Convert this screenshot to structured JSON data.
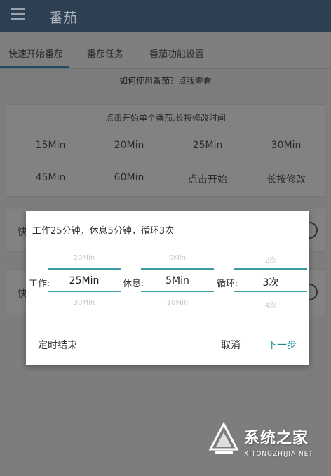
{
  "app": {
    "title": "番茄"
  },
  "tabs": [
    {
      "label": "快速开始番茄"
    },
    {
      "label": "番茄任务"
    },
    {
      "label": "番茄功能设置"
    }
  ],
  "help_link": "如何使用番茄？点我查看",
  "quick_card": {
    "title": "点击开始单个番茄,长按修改时间",
    "presets": [
      "15Min",
      "20Min",
      "25Min",
      "30Min",
      "45Min",
      "60Min",
      "点击开始",
      "长按修改"
    ]
  },
  "cards": [
    {
      "label_fragment": "快"
    },
    {
      "label_fragment": "快"
    }
  ],
  "dialog": {
    "title": "工作25分钟，休息5分钟，循环3次",
    "pickers": [
      {
        "label": "工作:",
        "prev": "20Min",
        "current": "25Min",
        "next": "30Min"
      },
      {
        "label": "休息:",
        "prev": "0Min",
        "current": "5Min",
        "next": "10Min"
      },
      {
        "label": "循环:",
        "prev": "2次",
        "current": "3次",
        "next": "4次"
      }
    ],
    "buttons": {
      "timed_end": "定时结束",
      "cancel": "取消",
      "next": "下一步"
    }
  },
  "watermark": {
    "cn": "系统之家",
    "en": "XITONGZHIJIA.NET"
  },
  "colors": {
    "appbar": "#2c3f53",
    "accent": "#1c8c95",
    "picker_line": "#3c9aa3",
    "scrim": "#7d7d7d"
  }
}
